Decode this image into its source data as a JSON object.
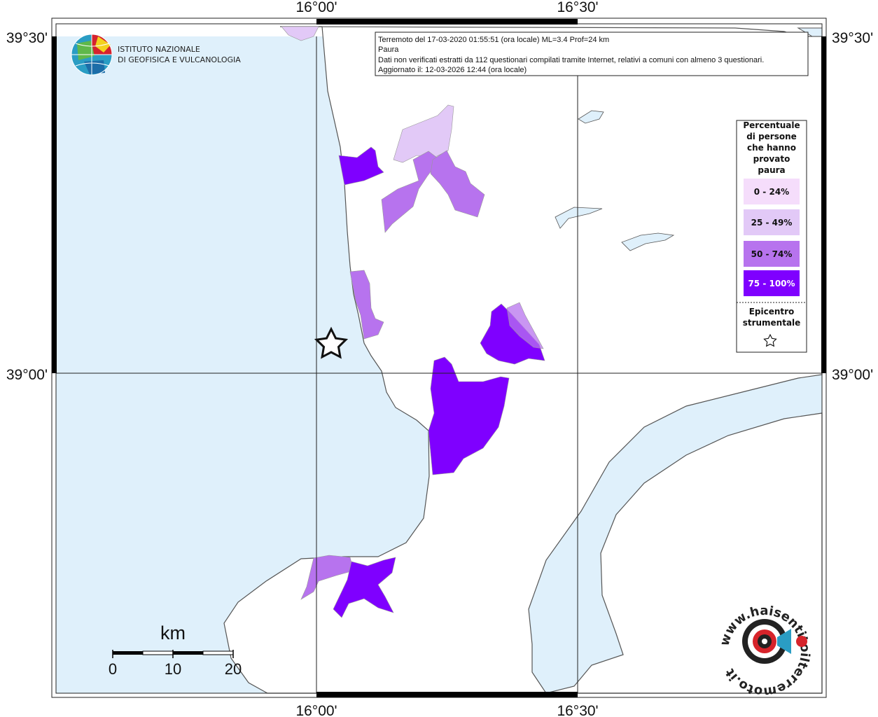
{
  "logo": {
    "line1": "ISTITUTO NAZIONALE",
    "line2": "DI GEOFISICA E VULCANOLOGIA"
  },
  "info": {
    "line1": "Terremoto del 17-03-2020 01:55:51 (ora locale) ML=3.4 Prof=24 km",
    "line2": "Paura",
    "line3": "Dati non verificati estratti da 112 questionari compilati tramite Internet, relativi a comuni con almeno 3 questionari.",
    "line4": "Aggiornato il: 12-03-2026 12:44 (ora locale)"
  },
  "axes": {
    "lon_top_left": "16°00'",
    "lon_top_right": "16°30'",
    "lon_bottom_left": "16°00'",
    "lon_bottom_right": "16°30'",
    "lat_left_top": "39°30'",
    "lat_left_bottom": "39°00'",
    "lat_right_top": "39°30'",
    "lat_right_bottom": "39°00'"
  },
  "legend": {
    "title_lines": [
      "Percentuale",
      "di persone",
      "che hanno",
      "provato",
      "paura"
    ],
    "classes": [
      {
        "label": "0 - 24%",
        "color": "#f5ddfb",
        "text_color": "#111111"
      },
      {
        "label": "25 - 49%",
        "color": "#e2c9f7",
        "text_color": "#111111"
      },
      {
        "label": "50 - 74%",
        "color": "#b773ee",
        "text_color": "#111111"
      },
      {
        "label": "75 - 100%",
        "color": "#7f00ff",
        "text_color": "#ffffff"
      }
    ],
    "epicenter_lines": [
      "Epicentro",
      "strumentale"
    ]
  },
  "scale_bar": {
    "unit": "km",
    "labels": [
      "0",
      "10",
      "20"
    ]
  },
  "watermark": {
    "text": "www.haisentitoilterremoto.it"
  },
  "colors": {
    "sea": "#dff0fb",
    "land": "#ffffff",
    "coast": "#555555"
  },
  "icons": {
    "logo": "ingv-globe-logo",
    "epicenter": "star-icon",
    "watermark": "haisentito-logo"
  }
}
